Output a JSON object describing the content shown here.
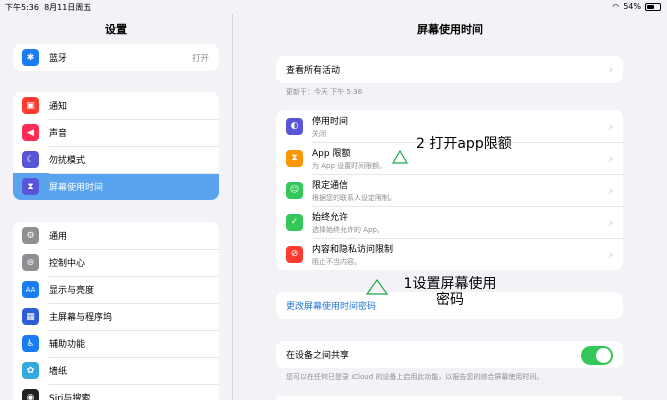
{
  "status": {
    "time": "下午5:36",
    "date": "8月11日周五",
    "battery": "54%"
  },
  "sidebar": {
    "title": "设置",
    "bluetooth": {
      "label": "蓝牙",
      "value": "打开"
    },
    "group2": [
      "通知",
      "声音",
      "勿扰模式",
      "屏幕使用时间"
    ],
    "group3": [
      "通用",
      "控制中心",
      "显示与亮度",
      "主屏幕与程序坞",
      "辅助功能",
      "墙纸",
      "Siri与搜索"
    ]
  },
  "main": {
    "title": "屏幕使用时间",
    "view_all": "查看所有活动",
    "updated": "更新于：今天 下午 5:36",
    "items": [
      {
        "title": "停用时间",
        "sub": "关闭"
      },
      {
        "title": "App 限额",
        "sub": "为 App 设置时间限额。"
      },
      {
        "title": "限定通信",
        "sub": "根据您的联系人设定限制。"
      },
      {
        "title": "始终允许",
        "sub": "选择始终允许的 App。"
      },
      {
        "title": "内容和隐私访问限制",
        "sub": "阻止不当内容。"
      }
    ],
    "change_passcode": "更改屏幕使用时间密码",
    "share_label": "在设备之间共享",
    "share_note": "您可以在任何已登录 iCloud 的设备上启用此功能，以报告您的综合屏幕使用时间。"
  },
  "annotations": {
    "a1": "2 打开app限额",
    "a2_line1": "1设置屏幕使用",
    "a2_line2": "密码"
  },
  "colors": {
    "selected": "#5aa3ef",
    "toggle": "#34c759",
    "link": "#1f74d6"
  }
}
